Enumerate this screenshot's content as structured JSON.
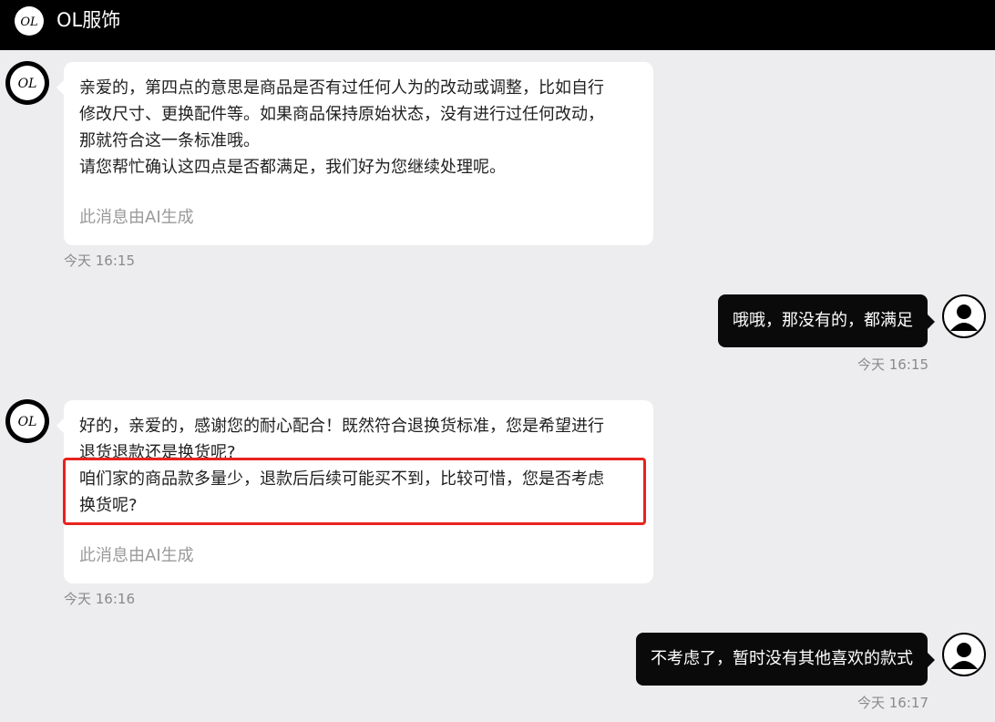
{
  "header": {
    "logo_text": "OL",
    "title": "OL服饰"
  },
  "messages": [
    {
      "sender": "shop",
      "avatar_text": "OL",
      "lines": [
        "亲爱的，第四点的意思是商品是否有过任何人为的改动或调整，比如自行",
        "修改尺寸、更换配件等。如果商品保持原始状态，没有进行过任何改动，",
        "那就符合这一条标准哦。",
        "请您帮忙确认这四点是否都满足，我们好为您继续处理呢。"
      ],
      "ai_note": "此消息由AI生成",
      "time": "今天 16:15"
    },
    {
      "sender": "user",
      "text": "哦哦，那没有的，都满足",
      "avatar_icon": "user-avatar-icon",
      "time": "今天 16:15"
    },
    {
      "sender": "shop",
      "avatar_text": "OL",
      "lines": [
        "好的，亲爱的，感谢您的耐心配合！既然符合退换货标准，您是希望进行",
        "退货退款还是换货呢?",
        "咱们家的商品款多量少，退款后后续可能买不到，比较可惜，您是否考虑",
        "换货呢?"
      ],
      "ai_note": "此消息由AI生成",
      "time": "今天 16:16"
    },
    {
      "sender": "user",
      "text": "不考虑了，暂时没有其他喜欢的款式",
      "avatar_icon": "user-avatar-icon",
      "time": "今天 16:17"
    }
  ],
  "colors": {
    "background": "#ededf0",
    "header": "#000000",
    "outgoing_bubble": "#0a0a0a",
    "incoming_bubble": "#ffffff",
    "highlight_box": "#e8231f"
  }
}
